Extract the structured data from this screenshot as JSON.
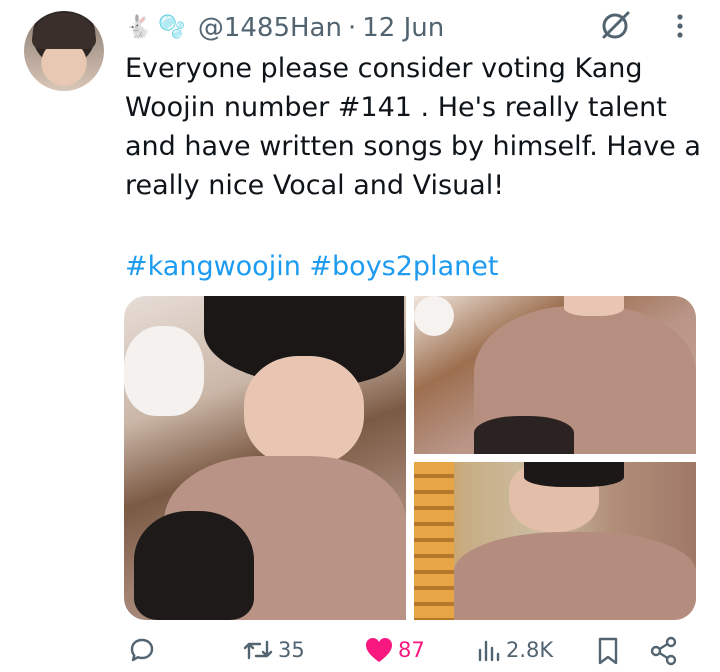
{
  "tweet": {
    "handle": "@1485Han",
    "separator": "·",
    "date": "12 Jun",
    "emojis": [
      "🐇",
      "🫧"
    ],
    "text": "Everyone please consider voting Kang Woojin number #141 . He's really talent and have written songs by himself. Have a really nice Vocal and Visual!",
    "hashtags": [
      "#kangwoojin",
      "#boys2planet"
    ]
  },
  "media": {
    "photos": [
      {
        "name": "photo-1"
      },
      {
        "name": "photo-2"
      },
      {
        "name": "photo-3"
      }
    ]
  },
  "actions": {
    "reply": {
      "icon": "reply-icon",
      "count": ""
    },
    "retweet": {
      "icon": "retweet-icon",
      "count": "35"
    },
    "like": {
      "icon": "heart-icon",
      "count": "87",
      "liked": true,
      "color": "#f91880"
    },
    "views": {
      "icon": "views-icon",
      "count": "2.8K"
    },
    "bookmark": {
      "icon": "bookmark-icon"
    },
    "share": {
      "icon": "share-icon"
    }
  },
  "colors": {
    "text": "#0f1419",
    "secondary": "#536471",
    "link": "#1d9bf0",
    "like": "#f91880"
  }
}
